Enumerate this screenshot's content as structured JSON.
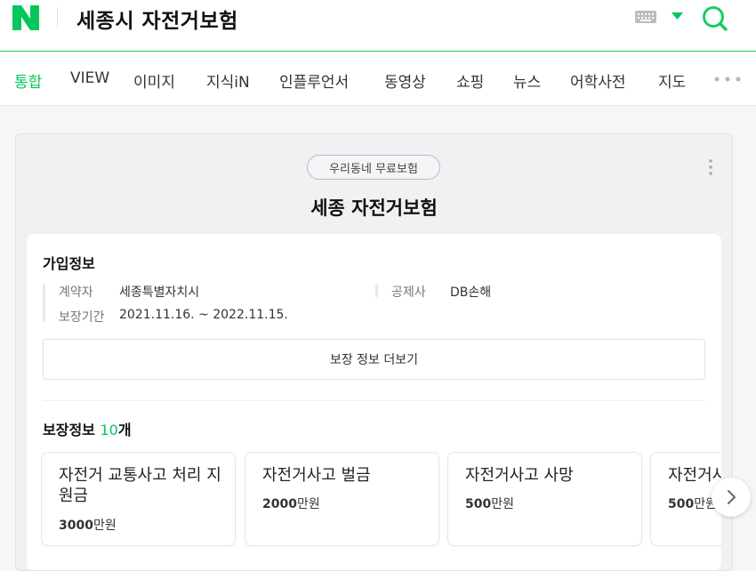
{
  "header": {
    "query": "세종시 자전거보험"
  },
  "tabs": [
    {
      "label": "통합",
      "active": true
    },
    {
      "label": "VIEW"
    },
    {
      "label": "이미지"
    },
    {
      "label": "지식iN"
    },
    {
      "label": "인플루언서"
    },
    {
      "label": "동영상"
    },
    {
      "label": "쇼핑"
    },
    {
      "label": "뉴스"
    },
    {
      "label": "어학사전"
    },
    {
      "label": "지도"
    }
  ],
  "card": {
    "badge": "우리동네 무료보험",
    "title": "세종 자전거보험",
    "enroll": {
      "title": "가입정보",
      "contractor_label": "계약자",
      "contractor_value": "세종특별자치시",
      "insurer_label": "공제사",
      "insurer_value": "DB손해",
      "period_label": "보장기간",
      "period_value": "2021.11.16. ~ 2022.11.15."
    },
    "more_button": "보장 정보 더보기",
    "coverage": {
      "title": "보장정보",
      "count": "10",
      "count_unit": "개",
      "items": [
        {
          "name": "자전거 교통사고 처리 지원금",
          "amount": "3000",
          "unit": "만원"
        },
        {
          "name": "자전거사고 벌금",
          "amount": "2000",
          "unit": "만원"
        },
        {
          "name": "자전거사고 사망",
          "amount": "500",
          "unit": "만원"
        },
        {
          "name": "자전거사",
          "amount": "500",
          "unit": "만원"
        }
      ]
    }
  },
  "colors": {
    "brand": "#03c75a",
    "search": "#19ce60"
  }
}
